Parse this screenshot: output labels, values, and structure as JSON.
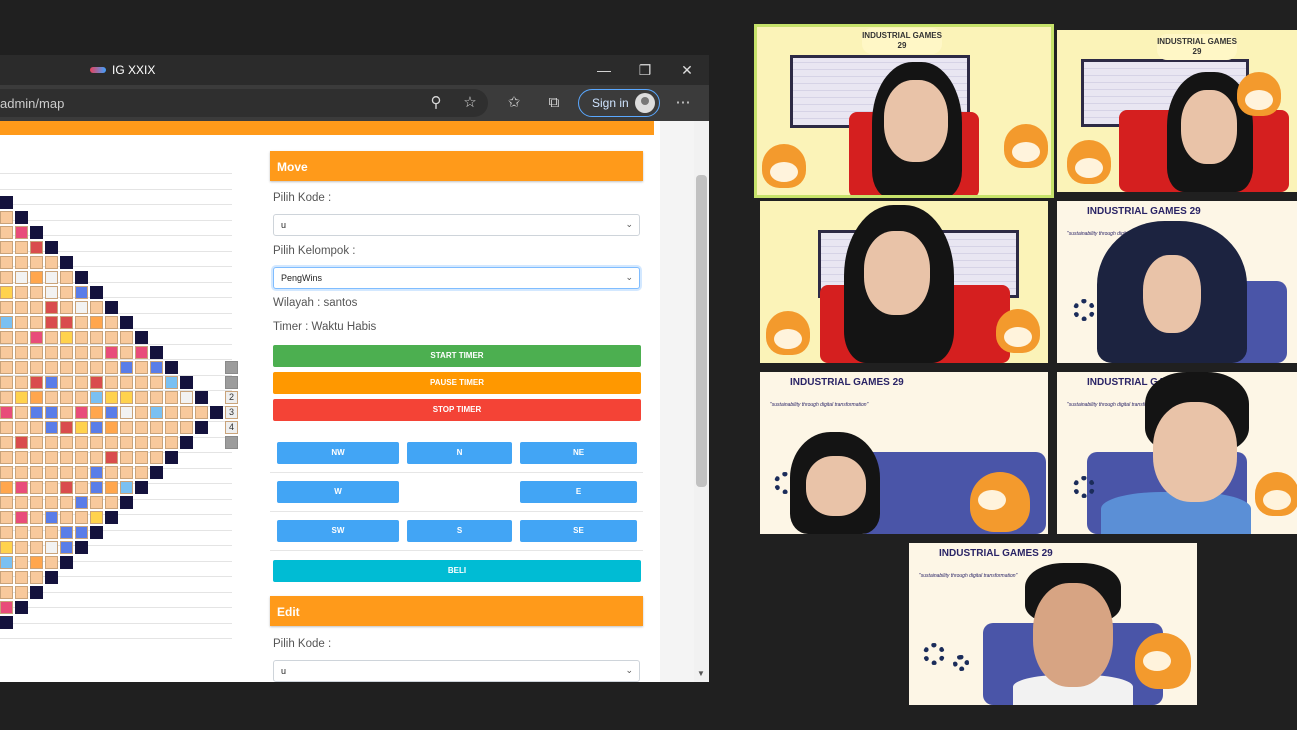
{
  "browser": {
    "tab_title": "IG XXIX",
    "url": "admin/map",
    "signin_label": "Sign in",
    "window_controls": [
      "minimize-icon",
      "restore-icon",
      "close-icon"
    ],
    "toolbar_icons": [
      "zoom-icon",
      "add-favorite-icon",
      "favorites-icon",
      "collections-icon",
      "more-icon"
    ]
  },
  "move_panel": {
    "title": "Move",
    "kode_label": "Pilih Kode :",
    "kode_value": "u",
    "kelompok_label": "Pilih Kelompok :",
    "kelompok_value": "PengWins",
    "wilayah_text": "Wilayah : santos",
    "timer_text": "Timer : Waktu Habis",
    "start_label": "START TIMER",
    "pause_label": "PAUSE TIMER",
    "stop_label": "STOP TIMER",
    "directions": [
      "NW",
      "N",
      "NE",
      "W",
      "E",
      "SW",
      "S",
      "SE"
    ],
    "beli_label": "BELI"
  },
  "edit_panel": {
    "title": "Edit",
    "kode_label": "Pilih Kode :",
    "kode_value": "u"
  },
  "map_side_numbers": [
    "2",
    "3",
    "4"
  ],
  "colors": {
    "orange": "#ff9a1a",
    "green": "#4caf50",
    "red": "#f44336",
    "blue": "#42a5f5",
    "cyan": "#00bcd4",
    "land": "#f8c99c",
    "sea": "#14123d",
    "active_speaker": "#c6e26a"
  },
  "video_tiles": [
    {
      "logo": "INDUSTRIAL GAMES 29"
    },
    {
      "logo": "INDUSTRIAL GAMES 29"
    },
    {
      "logo": ""
    },
    {
      "logo": "INDUSTRIAL GAMES 29",
      "tagline": "\"sustainability through digital transformation\""
    },
    {
      "logo": "INDUSTRIAL GAMES 29",
      "tagline": "\"sustainability through digital transformation\""
    },
    {
      "logo": "INDUSTRIAL GAMES 29",
      "tagline": "\"sustainability through digital transformation\""
    },
    {
      "logo": "INDUSTRIAL GAMES 29",
      "tagline": "\"sustainability through digital transformation\""
    }
  ]
}
